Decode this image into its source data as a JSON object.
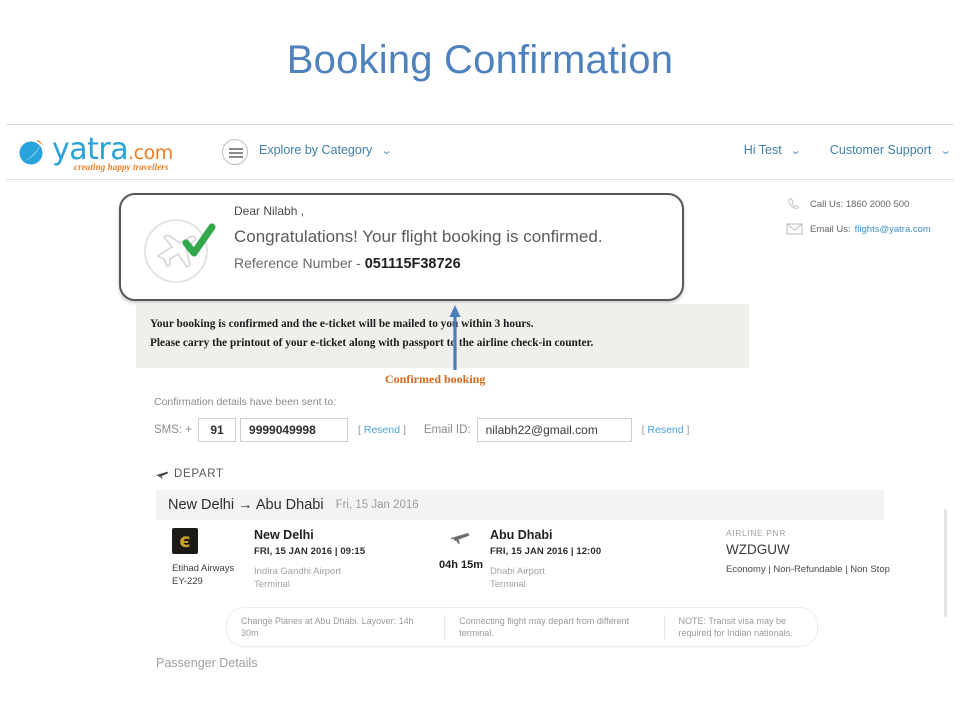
{
  "slide": {
    "title": "Booking Confirmation",
    "title_color": "#4f81bd"
  },
  "header": {
    "logo_text": "yatra",
    "logo_suffix": ".com",
    "logo_tagline": "creating happy travellers",
    "menu_icon": "hamburger-icon",
    "explore_label": "Explore by Category",
    "explore_caret": "⌄",
    "account_label": "Hi Test",
    "account_caret": "⌄",
    "support_label": "Customer Support",
    "support_caret": "⌄"
  },
  "contact": {
    "phone_icon": "phone-icon",
    "call_label": "Call Us: 1860 2000 500",
    "mail_icon": "envelope-icon",
    "email_prefix": "Email Us:",
    "email_value": "flights@yatra.com"
  },
  "confirmation": {
    "icon": "plane-in-circle-with-check-icon",
    "greeting": "Dear Nilabh ,",
    "headline": "Congratulations! Your flight booking is confirmed.",
    "ref_label": "Reference Number -",
    "ref_value": "051115F38726"
  },
  "info_strip": {
    "line1": "Your booking is confirmed and the e-ticket will be mailed to you within 3 hours.",
    "line2": "Please carry the printout of your e-ticket along with passport to the airline check-in counter."
  },
  "annotation": {
    "label": "Confirmed booking",
    "label_color": "#d2691e",
    "arrow_color": "#4a7ebb"
  },
  "sent_to": {
    "heading": "Confirmation details have been sent to:",
    "sms_label": "SMS: +",
    "country_code": "91",
    "phone": "9999049998",
    "sms_resend_open": "[",
    "sms_resend": "Resend",
    "sms_resend_close": "]",
    "email_label": "Email ID:",
    "email": "nilabh22@gmail.com",
    "email_resend_open": "[",
    "email_resend": "Resend",
    "email_resend_close": "]"
  },
  "depart": {
    "section_icon": "plane-icon",
    "section_label": "DEPART",
    "route": "New Delhi → Abu Dhabi",
    "route_date": "Fri, 15 Jan 2016"
  },
  "flight": {
    "airline_logo_glyph": "є",
    "airline_name": "Etihad Airways",
    "flight_number": "EY-229",
    "origin_city": "New Delhi",
    "origin_datetime": "FRI, 15 JAN 2016 | 09:15",
    "origin_airport": "Indira Gandhi Airport",
    "origin_terminal": "Terminal",
    "mid_icon": "plane-icon",
    "duration": "04h 15m",
    "dest_city": "Abu Dhabi",
    "dest_datetime": "FRI, 15 JAN 2016 | 12:00",
    "dest_airport": "Dhabi Airport",
    "dest_terminal": "Terminal",
    "pnr_label": "AIRLINE PNR",
    "pnr_value": "WZDGUW",
    "fare_info": "Economy | Non-Refundable | Non Stop"
  },
  "notes": {
    "note1": "Change Planes at Abu Dhabi. Layover: 14h 30m",
    "note2": "Connecting flight may depart from different terminal.",
    "note3": "NOTE: Transit visa may be required for Indian nationals."
  },
  "passenger": {
    "heading": "Passenger Details"
  }
}
